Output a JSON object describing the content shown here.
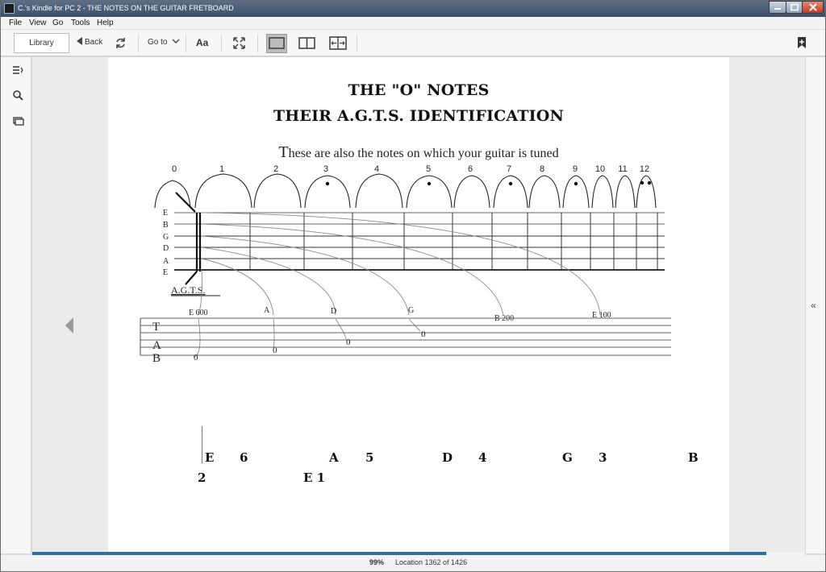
{
  "window": {
    "title": "C.'s Kindle for PC 2 - THE NOTES ON THE GUITAR FRETBOARD",
    "controls": [
      "minimize-icon",
      "maximize-icon",
      "close-icon"
    ]
  },
  "menu": [
    "File",
    "View",
    "Go",
    "Tools",
    "Help"
  ],
  "toolbar": {
    "library_label": "Library",
    "back_label": "Back",
    "goto_label": "Go to",
    "font_label": "Aa",
    "icons": [
      "back-arrow-icon",
      "sync-icon",
      "chevron-down-icon",
      "fullscreen-icon",
      "single-page-icon",
      "two-page-icon",
      "column-view-icon",
      "add-bookmark-icon"
    ]
  },
  "sidebar": {
    "icons": [
      "table-of-contents-icon",
      "search-icon",
      "flashcards-icon"
    ]
  },
  "right_bar": {
    "collapse_glyph": "«"
  },
  "page": {
    "heading1": "THE \"O\" NOTES",
    "heading2": "THEIR A.G.T.S. IDENTIFICATION",
    "subline_first": "T",
    "subline_rest": "hese are also the notes on which your guitar is tuned",
    "fret_numbers": [
      "0",
      "1",
      "2",
      "3",
      "4",
      "5",
      "6",
      "7",
      "8",
      "9",
      "10",
      "11",
      "12"
    ],
    "string_letters": [
      "E",
      "B",
      "G",
      "D",
      "A",
      "E"
    ],
    "agts_label": "A.G.T.S.",
    "tab_letters": [
      "T",
      "A",
      "B"
    ],
    "note_labels": [
      {
        "text": "E 600"
      },
      {
        "text": "A"
      },
      {
        "text": "D"
      },
      {
        "text": "G"
      },
      {
        "text": "B 200"
      },
      {
        "text": "E 100"
      }
    ],
    "o_marks": [
      "0",
      "0",
      "0",
      "0"
    ],
    "bottom_line1": [
      "E",
      "6",
      "A",
      "5",
      "D",
      "4",
      "G",
      "3",
      "B"
    ],
    "bottom_line2": [
      "2",
      "E 1"
    ]
  },
  "status": {
    "percent": "99%",
    "location": "Location 1362 of 1426",
    "progress_fraction": 0.95
  }
}
